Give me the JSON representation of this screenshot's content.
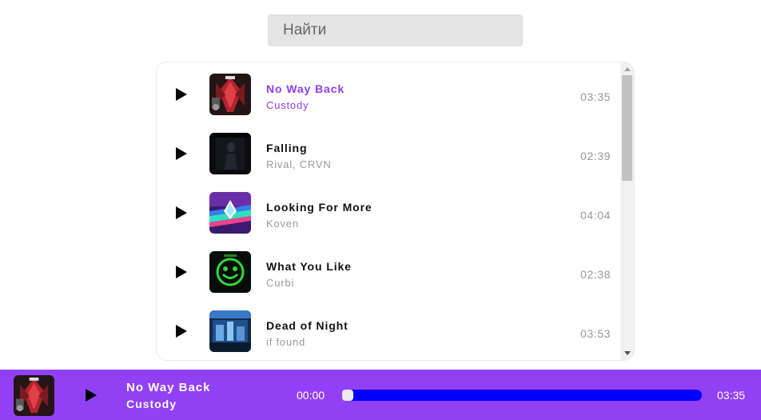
{
  "search": {
    "placeholder": "Найти"
  },
  "tracks": [
    {
      "title": "No Way Back",
      "artist": "Custody",
      "duration": "03:35",
      "active": true,
      "cover_icon": "red-abstract-cover"
    },
    {
      "title": "Falling",
      "artist": "Rival, CRVN",
      "duration": "02:39",
      "active": false,
      "cover_icon": "dark-figure-cover"
    },
    {
      "title": "Looking For More",
      "artist": "Koven",
      "duration": "04:04",
      "active": false,
      "cover_icon": "neon-prism-cover"
    },
    {
      "title": "What You Like",
      "artist": "Curbi",
      "duration": "02:38",
      "active": false,
      "cover_icon": "green-smiley-cover"
    },
    {
      "title": "Dead of Night",
      "artist": "if found",
      "duration": "03:53",
      "active": false,
      "cover_icon": "blue-city-cover"
    }
  ],
  "player": {
    "title": "No Way Back",
    "artist": "Custody",
    "current_time": "00:00",
    "total_time": "03:35",
    "progress": 0
  },
  "colors": {
    "accent": "#9240f5",
    "active_text": "#8f3ef2",
    "progress_fill": "#0000ff"
  }
}
